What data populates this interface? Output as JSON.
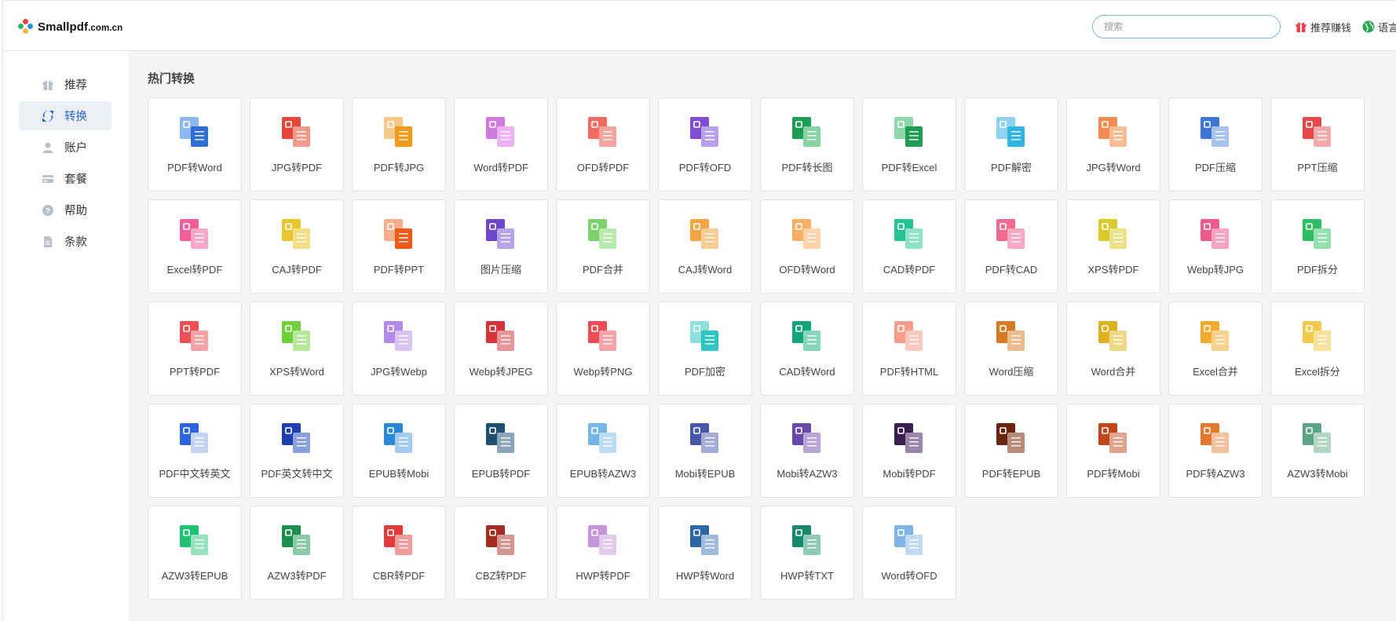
{
  "app": {
    "logo_main": "Smallpdf",
    "logo_suffix": ".com.cn",
    "search_placeholder": "搜索",
    "referral_label": "推荐赚钱",
    "language_label": "语言"
  },
  "sidebar": {
    "items": [
      {
        "label": "推荐",
        "icon": "gift-icon",
        "active": false
      },
      {
        "label": "转换",
        "icon": "convert-icon",
        "active": true
      },
      {
        "label": "账户",
        "icon": "user-icon",
        "active": false
      },
      {
        "label": "套餐",
        "icon": "card-icon",
        "active": false
      },
      {
        "label": "帮助",
        "icon": "help-icon",
        "active": false
      },
      {
        "label": "条款",
        "icon": "document-icon",
        "active": false
      }
    ]
  },
  "section_title": "热门转换",
  "tools": [
    {
      "label": "PDF转Word",
      "colors": [
        "#8fb8f2",
        "#2d6fd6"
      ],
      "icon": "pdf-to-word-icon"
    },
    {
      "label": "JPG转PDF",
      "colors": [
        "#e6453a",
        "#f49a8c"
      ],
      "icon": "jpg-to-pdf-icon"
    },
    {
      "label": "PDF转JPG",
      "colors": [
        "#f6c98a",
        "#f19a1c"
      ],
      "icon": "pdf-to-jpg-icon"
    },
    {
      "label": "Word转PDF",
      "colors": [
        "#d07ae0",
        "#efb1f5"
      ],
      "icon": "word-to-pdf-icon"
    },
    {
      "label": "OFD转PDF",
      "colors": [
        "#f36b63",
        "#f6a29d"
      ],
      "icon": "ofd-to-pdf-icon"
    },
    {
      "label": "PDF转OFD",
      "colors": [
        "#7e4fd6",
        "#b9a1ee"
      ],
      "icon": "pdf-to-ofd-icon"
    },
    {
      "label": "PDF转长图",
      "colors": [
        "#1e9e55",
        "#86d3a4"
      ],
      "icon": "pdf-to-long-image-icon"
    },
    {
      "label": "PDF转Excel",
      "colors": [
        "#8fd6aa",
        "#1f9e52"
      ],
      "icon": "pdf-to-excel-icon"
    },
    {
      "label": "PDF解密",
      "colors": [
        "#8fd3ee",
        "#31b4e2"
      ],
      "icon": "pdf-decrypt-icon"
    },
    {
      "label": "JPG转Word",
      "colors": [
        "#f58b52",
        "#f8bc96"
      ],
      "icon": "jpg-to-word-icon"
    },
    {
      "label": "PDF压缩",
      "colors": [
        "#3e75d9",
        "#a7c2ef"
      ],
      "icon": "pdf-compress-icon"
    },
    {
      "label": "PPT压缩",
      "colors": [
        "#e4484b",
        "#f4a9aa"
      ],
      "icon": "ppt-compress-icon"
    },
    {
      "label": "Excel转PDF",
      "colors": [
        "#f25e9a",
        "#f7a7c7"
      ],
      "icon": "excel-to-pdf-icon"
    },
    {
      "label": "CAJ转PDF",
      "colors": [
        "#e9c62e",
        "#f3df85"
      ],
      "icon": "caj-to-pdf-icon"
    },
    {
      "label": "PDF转PPT",
      "colors": [
        "#f7ae8c",
        "#ee5a19"
      ],
      "icon": "pdf-to-ppt-icon"
    },
    {
      "label": "图片压缩",
      "colors": [
        "#6d47c8",
        "#b7a4e6"
      ],
      "icon": "image-compress-icon"
    },
    {
      "label": "PDF合并",
      "colors": [
        "#7ed36e",
        "#b9e9ad"
      ],
      "icon": "pdf-merge-icon"
    },
    {
      "label": "CAJ转Word",
      "colors": [
        "#f5a546",
        "#f8cd93"
      ],
      "icon": "caj-to-word-icon"
    },
    {
      "label": "OFD转Word",
      "colors": [
        "#f8b063",
        "#fbd3a6"
      ],
      "icon": "ofd-to-word-icon"
    },
    {
      "label": "CAD转PDF",
      "colors": [
        "#27c294",
        "#8ee3c7"
      ],
      "icon": "cad-to-pdf-icon"
    },
    {
      "label": "PDF转CAD",
      "colors": [
        "#f06a92",
        "#f6a9c0"
      ],
      "icon": "pdf-to-cad-icon"
    },
    {
      "label": "XPS转PDF",
      "colors": [
        "#d8cb2b",
        "#ebe28a"
      ],
      "icon": "xps-to-pdf-icon"
    },
    {
      "label": "Webp转JPG",
      "colors": [
        "#f0598b",
        "#f6a4c0"
      ],
      "icon": "webp-to-jpg-icon"
    },
    {
      "label": "PDF拆分",
      "colors": [
        "#2fbd62",
        "#94dfae"
      ],
      "icon": "pdf-split-icon"
    },
    {
      "label": "PPT转PDF",
      "colors": [
        "#ef4f55",
        "#f6a2a5"
      ],
      "icon": "ppt-to-pdf-icon"
    },
    {
      "label": "XPS转Word",
      "colors": [
        "#6fcf3c",
        "#b7e79d"
      ],
      "icon": "xps-to-word-icon"
    },
    {
      "label": "JPG转Webp",
      "colors": [
        "#b28ae8",
        "#d8c4f4"
      ],
      "icon": "jpg-to-webp-icon"
    },
    {
      "label": "Webp转JPEG",
      "colors": [
        "#d4333b",
        "#e89599"
      ],
      "icon": "webp-to-jpeg-icon"
    },
    {
      "label": "Webp转PNG",
      "colors": [
        "#ee4b54",
        "#f5a3a7"
      ],
      "icon": "webp-to-png-icon"
    },
    {
      "label": "PDF加密",
      "colors": [
        "#8fe0dc",
        "#2ec6c0"
      ],
      "icon": "pdf-encrypt-icon"
    },
    {
      "label": "CAD转Word",
      "colors": [
        "#12a57a",
        "#86d6bd"
      ],
      "icon": "cad-to-word-icon"
    },
    {
      "label": "PDF转HTML",
      "colors": [
        "#f89d8b",
        "#f8c9bd"
      ],
      "icon": "pdf-to-html-icon"
    },
    {
      "label": "Word压缩",
      "colors": [
        "#d77a25",
        "#ecbb8d"
      ],
      "icon": "word-compress-icon"
    },
    {
      "label": "Word合并",
      "colors": [
        "#ddb21e",
        "#efd986"
      ],
      "icon": "word-merge-icon"
    },
    {
      "label": "Excel合并",
      "colors": [
        "#f2ab2c",
        "#f8d28b"
      ],
      "icon": "excel-merge-icon"
    },
    {
      "label": "Excel拆分",
      "colors": [
        "#f2cb4e",
        "#f8e29b"
      ],
      "icon": "excel-split-icon"
    },
    {
      "label": "PDF中文转英文",
      "colors": [
        "#2c63e0",
        "#c2d3f5"
      ],
      "icon": "pdf-chinese-to-english-icon"
    },
    {
      "label": "PDF英文转中文",
      "colors": [
        "#1f3fb0",
        "#8aa0dc"
      ],
      "icon": "pdf-english-to-chinese-icon"
    },
    {
      "label": "EPUB转Mobi",
      "colors": [
        "#2b88d8",
        "#a3cbef"
      ],
      "icon": "epub-to-mobi-icon"
    },
    {
      "label": "EPUB转PDF",
      "colors": [
        "#1e4f6e",
        "#8aa6bb"
      ],
      "icon": "epub-to-pdf-icon"
    },
    {
      "label": "EPUB转AZW3",
      "colors": [
        "#76b6e6",
        "#bcdcf3"
      ],
      "icon": "epub-to-azw3-icon"
    },
    {
      "label": "Mobi转EPUB",
      "colors": [
        "#4a57a8",
        "#a4abd9"
      ],
      "icon": "mobi-to-epub-icon"
    },
    {
      "label": "Mobi转AZW3",
      "colors": [
        "#6a4aa8",
        "#b7a5d9"
      ],
      "icon": "mobi-to-azw3-icon"
    },
    {
      "label": "Mobi转PDF",
      "colors": [
        "#3b1f4e",
        "#9a86ab"
      ],
      "icon": "mobi-to-pdf-icon"
    },
    {
      "label": "PDF转EPUB",
      "colors": [
        "#6b2410",
        "#b98c7a"
      ],
      "icon": "pdf-to-epub-icon"
    },
    {
      "label": "PDF转Mobi",
      "colors": [
        "#c1451b",
        "#e0a48d"
      ],
      "icon": "pdf-to-mobi-icon"
    },
    {
      "label": "PDF转AZW3",
      "colors": [
        "#e5782f",
        "#f3c19c"
      ],
      "icon": "pdf-to-azw3-icon"
    },
    {
      "label": "AZW3转Mobi",
      "colors": [
        "#5fa386",
        "#b2d5c6"
      ],
      "icon": "azw3-to-mobi-icon"
    },
    {
      "label": "AZW3转EPUB",
      "colors": [
        "#1fc071",
        "#94e3bc"
      ],
      "icon": "azw3-to-epub-icon"
    },
    {
      "label": "AZW3转PDF",
      "colors": [
        "#1b8f4f",
        "#8ccaa6"
      ],
      "icon": "azw3-to-pdf-icon"
    },
    {
      "label": "CBR转PDF",
      "colors": [
        "#e33b3b",
        "#f19b9b"
      ],
      "icon": "cbr-to-pdf-icon"
    },
    {
      "label": "CBZ转PDF",
      "colors": [
        "#a52a20",
        "#d49690"
      ],
      "icon": "cbz-to-pdf-icon"
    },
    {
      "label": "HWP转PDF",
      "colors": [
        "#c596db",
        "#e2caed"
      ],
      "icon": "hwp-to-pdf-icon"
    },
    {
      "label": "HWP转Word",
      "colors": [
        "#2c66a8",
        "#9ebbde"
      ],
      "icon": "hwp-to-word-icon"
    },
    {
      "label": "HWP转TXT",
      "colors": [
        "#178a6c",
        "#8cc9b6"
      ],
      "icon": "hwp-to-txt-icon"
    },
    {
      "label": "Word转OFD",
      "colors": [
        "#7fb4e4",
        "#bfdaf2"
      ],
      "icon": "word-to-ofd-icon"
    }
  ]
}
